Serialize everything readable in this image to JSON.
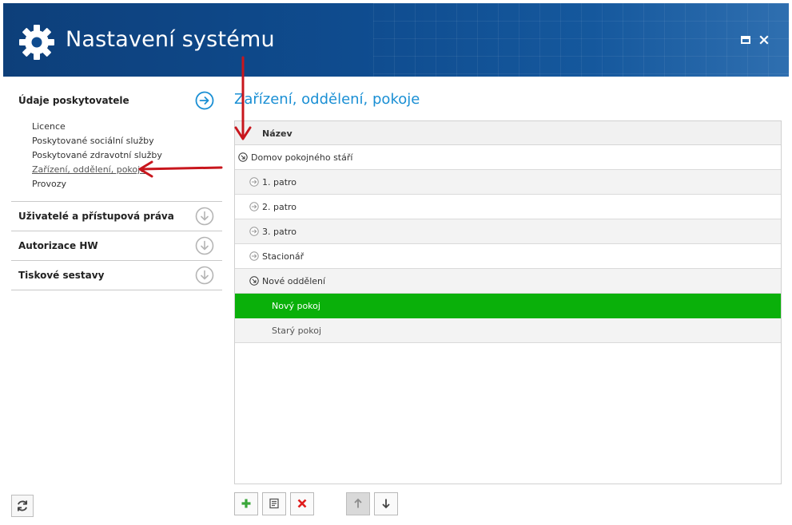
{
  "window": {
    "title": "Nastavení systému",
    "icon": "gear-icon",
    "maximize_icon": "maximize-icon",
    "close_icon": "close-icon"
  },
  "colors": {
    "header": "#0f4c8f",
    "accent": "#1a8fd4",
    "selected_row": "#0ab00a",
    "add_green": "#3aa63a",
    "delete_red": "#e01d1d",
    "annotation_arrow": "#c8161d"
  },
  "sidebar": {
    "sections": [
      {
        "title": "Údaje poskytovatele",
        "icon": "arrow-right-circle-icon",
        "expanded": true,
        "items": [
          {
            "label": "Licence",
            "active": false
          },
          {
            "label": "Poskytované sociální služby",
            "active": false
          },
          {
            "label": "Poskytované zdravotní služby",
            "active": false
          },
          {
            "label": "Zařízení, oddělení, pokoje",
            "active": true
          },
          {
            "label": "Provozy",
            "active": false
          }
        ]
      },
      {
        "title": "Uživatelé a přístupová práva",
        "icon": "arrow-down-circle-icon",
        "expanded": false
      },
      {
        "title": "Autorizace HW",
        "icon": "arrow-down-circle-icon",
        "expanded": false
      },
      {
        "title": "Tiskové sestavy",
        "icon": "arrow-down-circle-icon",
        "expanded": false
      }
    ],
    "refresh_icon": "refresh-icon"
  },
  "main": {
    "title": "Zařízení, oddělení, pokoje",
    "tree": {
      "column_header": "Název",
      "rows": [
        {
          "label": "Domov pokojného stáří",
          "icon": "collapse-circle-icon",
          "level": 0,
          "selected": false
        },
        {
          "label": "1. patro",
          "icon": "expand-circle-icon",
          "level": 1,
          "selected": false
        },
        {
          "label": "2. patro",
          "icon": "expand-circle-icon",
          "level": 1,
          "selected": false
        },
        {
          "label": "3. patro",
          "icon": "expand-circle-icon",
          "level": 1,
          "selected": false
        },
        {
          "label": "Stacionář",
          "icon": "expand-circle-icon",
          "level": 1,
          "selected": false
        },
        {
          "label": "Nové oddělení",
          "icon": "collapse-circle-icon",
          "level": 1,
          "selected": false
        },
        {
          "label": "Nový pokoj",
          "icon": "",
          "level": 2,
          "selected": true
        },
        {
          "label": "Starý pokoj",
          "icon": "",
          "level": 2,
          "selected": false
        }
      ]
    },
    "toolbar": {
      "add_icon": "plus-icon",
      "edit_icon": "edit-document-icon",
      "delete_icon": "delete-x-icon",
      "move_up_icon": "arrow-up-icon",
      "move_down_icon": "arrow-down-icon",
      "move_up_enabled": false
    }
  }
}
